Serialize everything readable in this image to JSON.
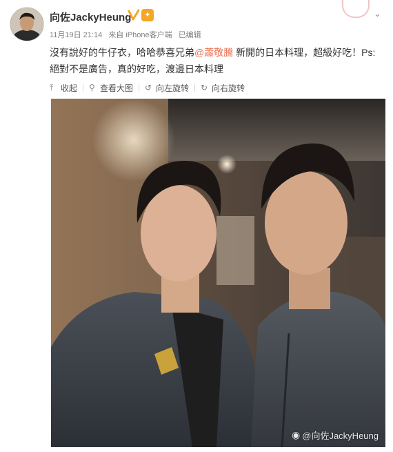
{
  "user": {
    "name": "向佐JackyHeung",
    "verified_color": "#f5a623",
    "badge_icon": "vip-icon"
  },
  "meta": {
    "date": "11月19日 21:14",
    "source": "来自 iPhone客户端",
    "edited": "已编辑"
  },
  "post": {
    "text_before": "沒有說好的牛仔衣，哈哈恭喜兄弟",
    "mention": "@蕭敬騰",
    "text_after": " 新開的日本料理，超級好吃！Ps: 絕對不是廣告，真的好吃，渡邊日本料理"
  },
  "actions": {
    "collapse": "收起",
    "view_large": "查看大图",
    "rotate_left": "向左旋转",
    "rotate_right": "向右旋转"
  },
  "image": {
    "watermark": "@向佐JackyHeung"
  },
  "colors": {
    "mention": "#eb7350",
    "muted": "#808080"
  }
}
